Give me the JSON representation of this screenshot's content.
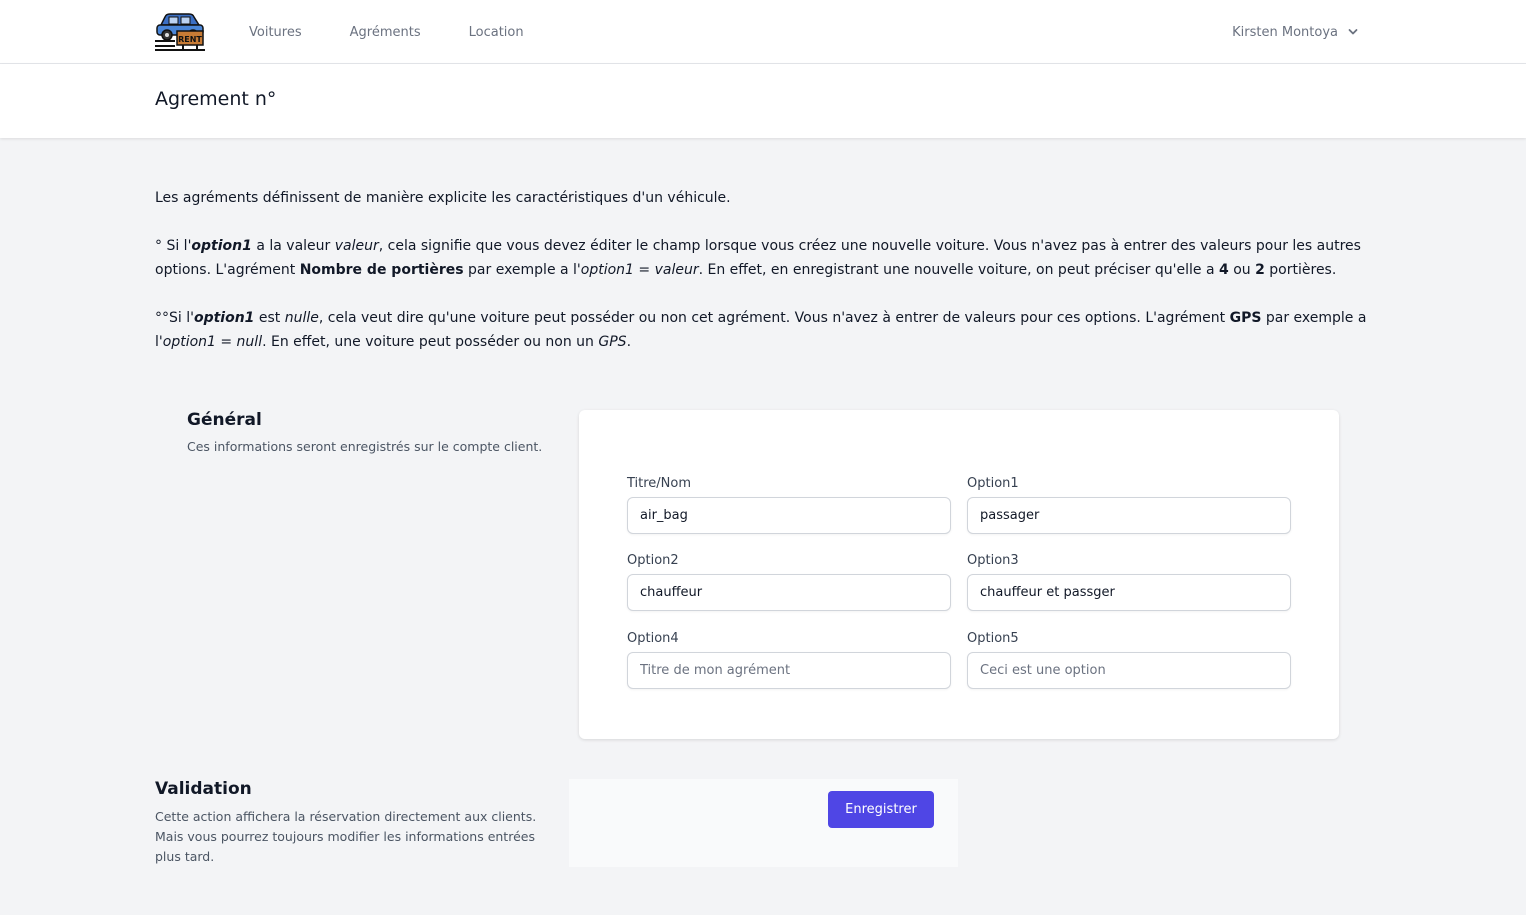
{
  "nav": {
    "links": [
      "Voitures",
      "Agréments",
      "Location"
    ],
    "user_name": "Kirsten Montoya"
  },
  "header": {
    "title": "Agrement n°"
  },
  "intro": {
    "p1": "Les agréments définissent de manière explicite les caractéristiques d'un véhicule.",
    "p2": {
      "a": "° Si l'",
      "b": "option1",
      "c": " a la valeur ",
      "d": "valeur",
      "e": ", cela signifie que vous devez éditer le champ lorsque vous créez une nouvelle voiture. Vous n'avez pas à entrer des valeurs pour les autres options. L'agrément ",
      "f": "Nombre de portières",
      "g": " par exemple a l'",
      "h": "option1 = valeur",
      "i": ". En effet, en enregistrant une nouvelle voiture, on peut préciser qu'elle a ",
      "j": "4",
      "k": " ou ",
      "l": "2",
      "m": " portières."
    },
    "p3": {
      "a": "°°Si l'",
      "b": "option1",
      "c": " est ",
      "d": "nulle",
      "e": ", cela veut dire qu'une voiture peut posséder ou non cet agrément. Vous n'avez à entrer de valeurs pour ces options. L'agrément ",
      "f": "GPS",
      "g": " par exemple a l'",
      "h": "option1 = null",
      "i": ". En effet, une voiture peut posséder ou non un ",
      "j": "GPS",
      "k": "."
    }
  },
  "general": {
    "title": "Général",
    "desc": "Ces informations seront enregistrés sur le compte client."
  },
  "form": {
    "title_label": "Titre/Nom",
    "title_value": "air_bag",
    "option1_label": "Option1",
    "option1_value": "passager",
    "option2_label": "Option2",
    "option2_value": "chauffeur",
    "option3_label": "Option3",
    "option3_value": "chauffeur et passger",
    "option4_label": "Option4",
    "option4_placeholder": "Titre de mon agrément",
    "option5_label": "Option5",
    "option5_placeholder": "Ceci est une option"
  },
  "validation": {
    "title": "Validation",
    "desc": "Cette action affichera la réservation directement aux clients. Mais vous pourrez toujours modifier les informations entrées plus tard.",
    "save_label": "Enregistrer"
  },
  "colors": {
    "accent": "#4f46e5",
    "background": "#f3f4f6"
  },
  "icons": {
    "logo": "rent-car-logo-icon",
    "user_menu": "chevron-down-icon"
  }
}
